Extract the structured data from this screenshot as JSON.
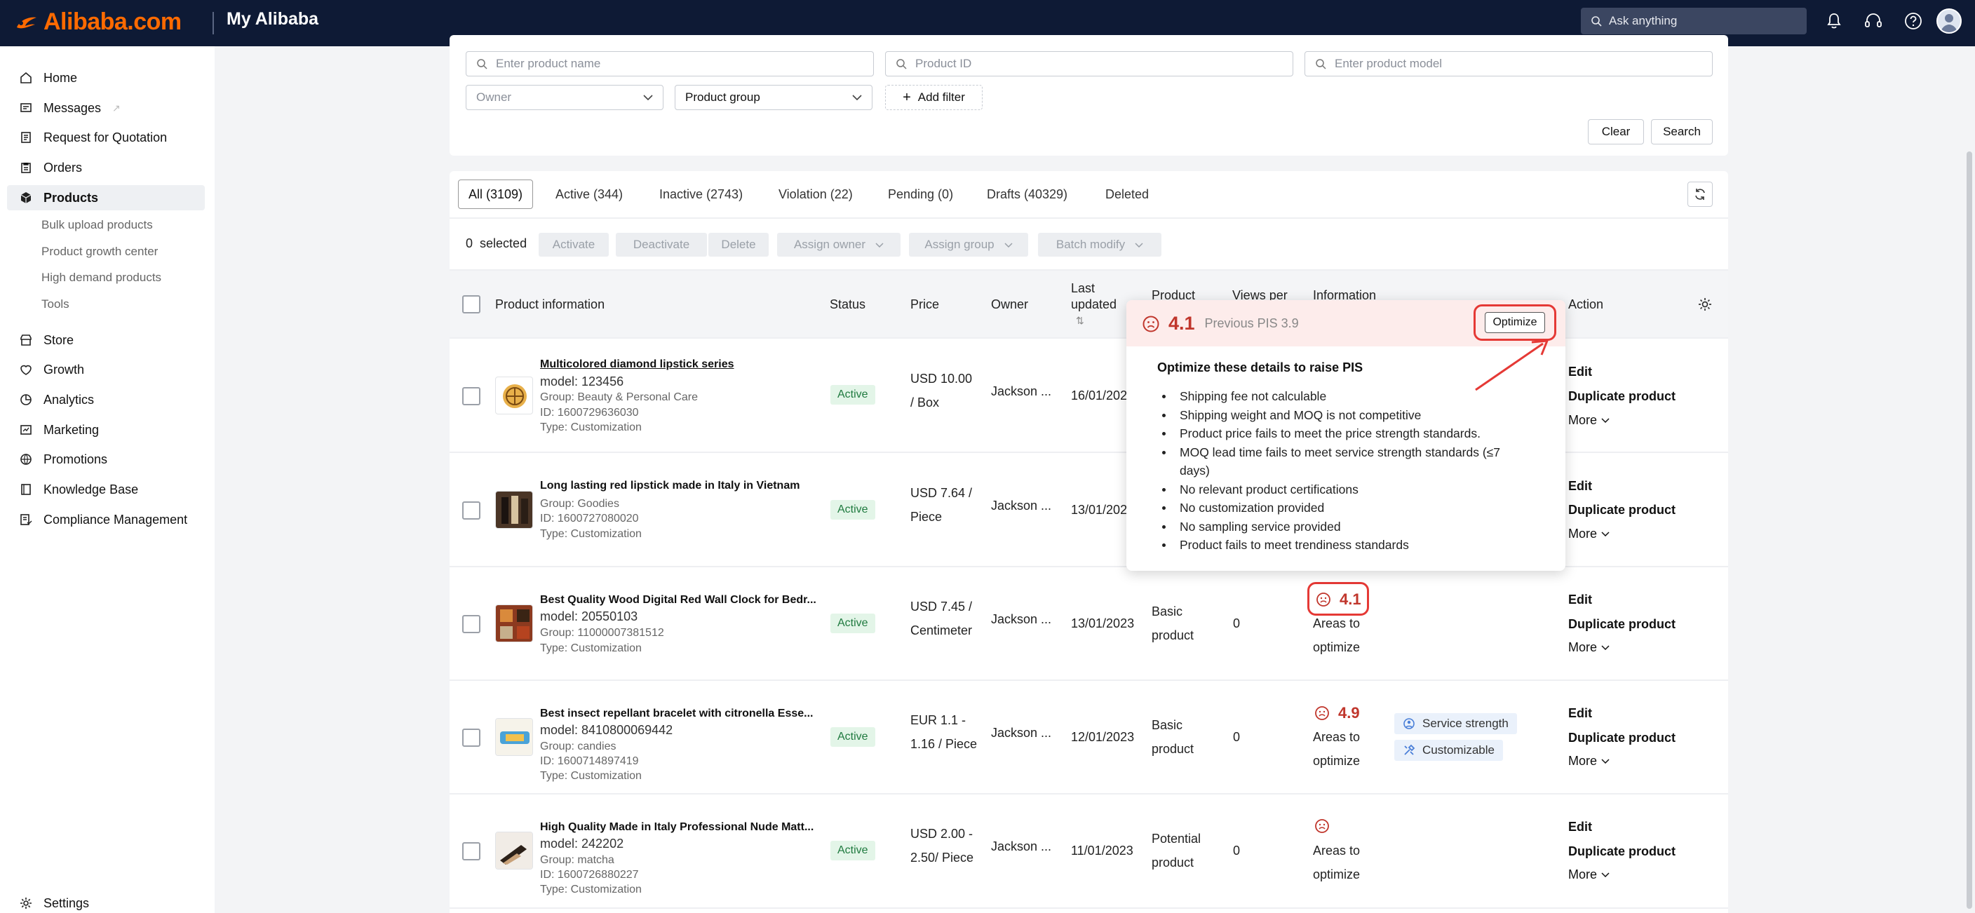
{
  "brand": {
    "logo": "Alibaba.com",
    "app": "My Alibaba"
  },
  "search": {
    "placeholder": "Ask anything"
  },
  "top_icons": [
    "bell-icon",
    "headset-icon",
    "help-icon",
    "avatar"
  ],
  "sidebar": {
    "items": [
      {
        "label": "Home",
        "icon": "home-icon"
      },
      {
        "label": "Messages",
        "icon": "message-icon"
      },
      {
        "label": "Request for Quotation",
        "icon": "rfq-icon"
      },
      {
        "label": "Orders",
        "icon": "orders-icon"
      },
      {
        "label": "Products",
        "icon": "box-icon",
        "active": true
      },
      {
        "label": "Store",
        "icon": "store-icon"
      },
      {
        "label": "Growth",
        "icon": "growth-icon"
      },
      {
        "label": "Analytics",
        "icon": "analytics-icon"
      },
      {
        "label": "Marketing",
        "icon": "marketing-icon"
      },
      {
        "label": "Promotions",
        "icon": "promotions-icon"
      },
      {
        "label": "Knowledge Base",
        "icon": "book-icon"
      },
      {
        "label": "Compliance Management",
        "icon": "compliance-icon"
      },
      {
        "label": "Settings",
        "icon": "gear-icon"
      }
    ],
    "subitems": [
      "Bulk upload products",
      "Product growth center",
      "High demand products",
      "Tools"
    ]
  },
  "filters": {
    "product_name_placeholder": "Enter product name",
    "product_id_placeholder": "Product ID",
    "product_model_placeholder": "Enter product model",
    "owner": "Owner",
    "product_group": "Product group",
    "add_filter": "Add filter",
    "clear": "Clear",
    "search": "Search"
  },
  "tabs": [
    "All (3109)",
    "Active (344)",
    "Inactive (2743)",
    "Violation (22)",
    "Pending (0)",
    "Drafts (40329)",
    "Deleted"
  ],
  "batch": {
    "count": "0",
    "selected": "selected",
    "activate": "Activate",
    "deactivate": "Deactivate",
    "delete": "Delete",
    "assign_owner": "Assign owner",
    "assign_group": "Assign group",
    "batch_modify": "Batch modify"
  },
  "columns": {
    "product_info": "Product information",
    "status": "Status",
    "price": "Price",
    "owner": "Owner",
    "last_updated_1": "Last",
    "last_updated_2": "updated",
    "product_1": "Product",
    "views_1": "Views per",
    "information": "Information",
    "action": "Action"
  },
  "rows": [
    {
      "name": "Multicolored diamond lipstick series",
      "model": "model: 123456",
      "group": "Group: Beauty & Personal Care",
      "id": "ID: 1600729636030",
      "type": "Type: Customization",
      "status": "Active",
      "price1": "USD 10.00",
      "price2": "/ Box",
      "owner": "Jackson ...",
      "date": "16/01/2023",
      "actions": [
        "Edit",
        "Duplicate product",
        "More"
      ]
    },
    {
      "name": "Long lasting red lipstick made in Italy in Vietnam",
      "model": "",
      "group": "Group: Goodies",
      "id": "ID: 1600727080020",
      "type": "Type: Customization",
      "status": "Active",
      "price1": "USD 7.64 /",
      "price2": "Piece",
      "owner": "Jackson ...",
      "date": "13/01/2023",
      "actions": [
        "Edit",
        "Duplicate product",
        "More"
      ]
    },
    {
      "name": "Best Quality Wood Digital Red Wall Clock for Bedr...",
      "model": "model: 20550103",
      "group": "Group: 11000007381512",
      "id": "ID: 11000007381512",
      "type": "Type: Customization",
      "status": "Active",
      "price1": "USD 7.45 /",
      "price2": "Centimeter",
      "owner": "Jackson ...",
      "date": "13/01/2023",
      "ptype1": "Basic",
      "ptype2": "product",
      "views": "0",
      "pis": "4.1",
      "info1": "Areas to",
      "info2": "optimize",
      "actions": [
        "Edit",
        "Duplicate product",
        "More"
      ]
    },
    {
      "name": "Best insect repellant bracelet with citronella Esse...",
      "model": "model: 8410800069442",
      "group": "Group: candies",
      "id": "ID: 1600714897419",
      "type": "Type: Customization",
      "status": "Active",
      "price1": "EUR 1.1 -",
      "price2": "1.16 / Piece",
      "owner": "Jackson ...",
      "date": "12/01/2023",
      "ptype1": "Basic",
      "ptype2": "product",
      "views": "0",
      "pis": "4.9",
      "info1": "Areas to",
      "info2": "optimize",
      "tags": [
        "Service strength",
        "Customizable"
      ],
      "actions": [
        "Edit",
        "Duplicate product",
        "More"
      ]
    },
    {
      "name": "High Quality Made in Italy Professional Nude Matt...",
      "model": "model: 242202",
      "group": "Group: matcha",
      "id": "ID: 1600726880227",
      "type": "Type: Customization",
      "status": "Active",
      "price1": "USD 2.00 -",
      "price2": "2.50/ Piece",
      "owner": "Jackson ...",
      "date": "11/01/2023",
      "ptype1": "Potential",
      "ptype2": "product",
      "views": "0",
      "pis": "",
      "info1": "Areas to",
      "info2": "optimize",
      "actions": [
        "Edit",
        "Duplicate product",
        "More"
      ]
    }
  ],
  "popover": {
    "score": "4.1",
    "previous": "Previous PIS 3.9",
    "optimize": "Optimize",
    "heading": "Optimize these details to raise PIS",
    "bullets": [
      "Shipping fee not calculable",
      "Shipping weight and MOQ is not competitive",
      "Product price fails to meet the price strength standards.",
      "MOQ lead time fails to meet service strength standards (≤7 days)",
      "No relevant product certifications",
      "No customization provided",
      "No sampling service provided",
      "Product fails to meet trendiness standards"
    ]
  },
  "colors": {
    "topbar": "#0e1a35",
    "brand": "#ff6a00",
    "pis": "#c0362c",
    "highlight": "#e53935"
  }
}
